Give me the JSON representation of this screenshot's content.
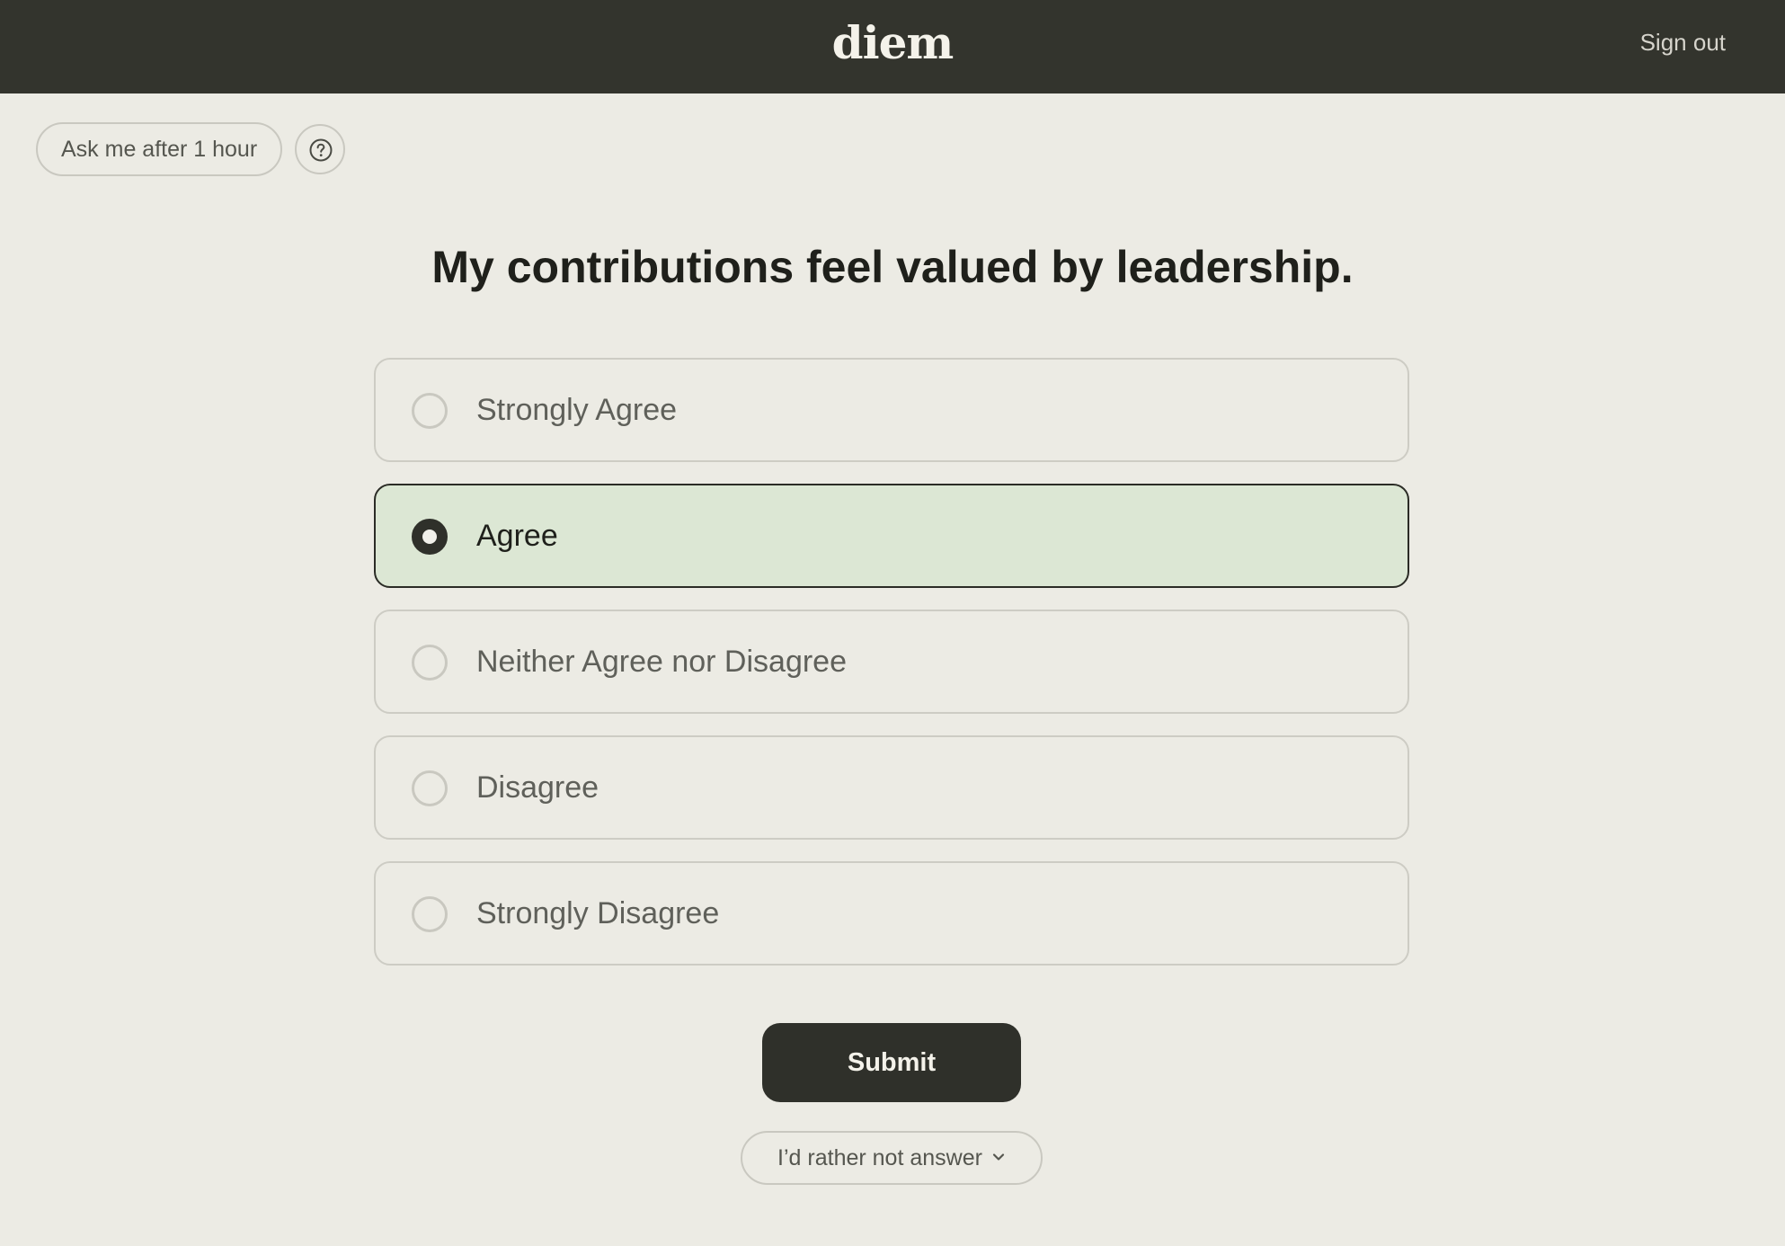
{
  "header": {
    "logo": "diem",
    "sign_out_label": "Sign out"
  },
  "toolbar": {
    "snooze_label": "Ask me after 1 hour",
    "help_icon": "question-circle-icon"
  },
  "survey": {
    "question": "My contributions feel valued by leadership.",
    "options": [
      {
        "label": "Strongly Agree",
        "selected": false
      },
      {
        "label": "Agree",
        "selected": true
      },
      {
        "label": "Neither Agree nor Disagree",
        "selected": false
      },
      {
        "label": "Disagree",
        "selected": false
      },
      {
        "label": "Strongly Disagree",
        "selected": false
      }
    ],
    "submit_label": "Submit",
    "skip_label": "I’d rather not answer",
    "skip_icon": "chevron-down-icon"
  },
  "colors": {
    "header_bg": "#33342D",
    "page_bg": "#ECEBE4",
    "selected_bg": "#DCE7D4",
    "primary_button": "#2F302A"
  }
}
